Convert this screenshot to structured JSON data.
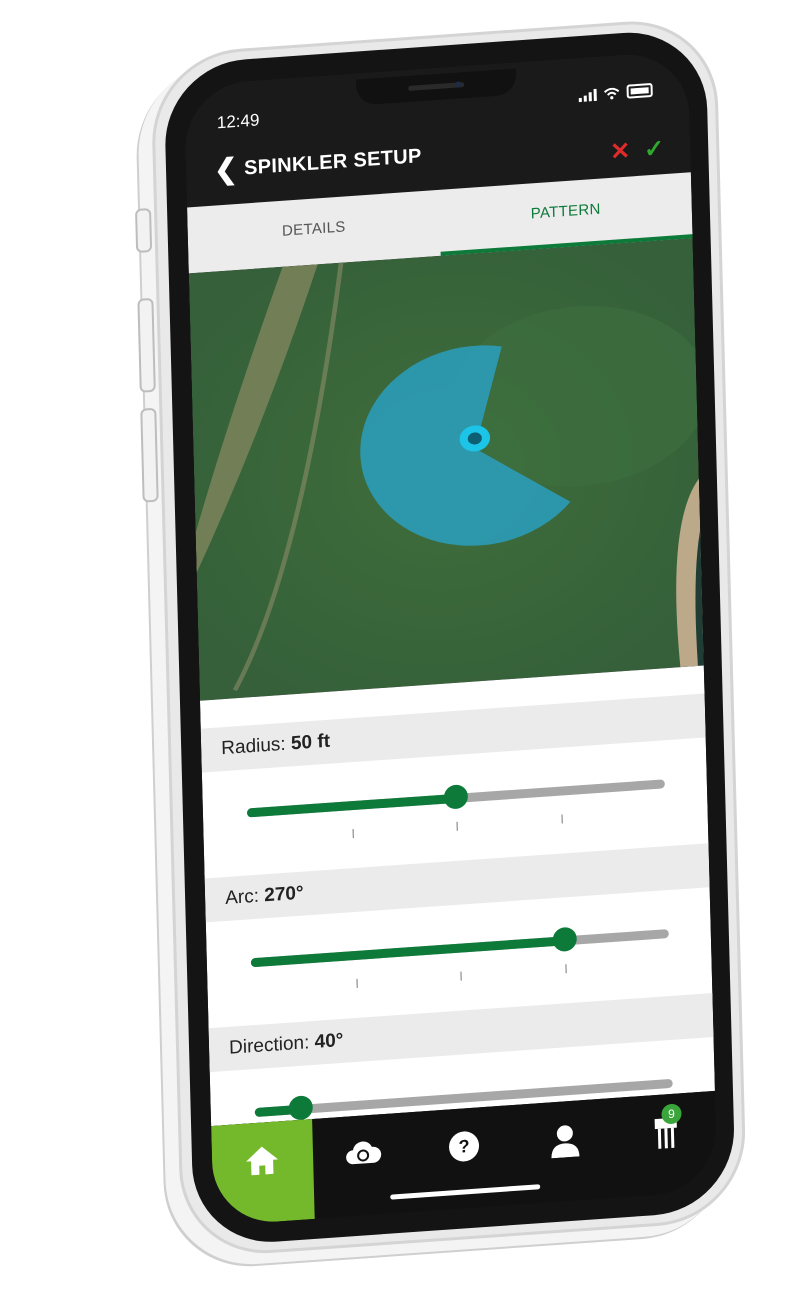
{
  "status": {
    "time": "12:49"
  },
  "header": {
    "title": "SPINKLER SETUP",
    "back_icon": "chevron-left-icon",
    "cancel_icon": "close-icon",
    "confirm_icon": "check-icon"
  },
  "tabs": [
    {
      "label": "DETAILS",
      "active": false
    },
    {
      "label": "PATTERN",
      "active": true
    }
  ],
  "controls": {
    "radius": {
      "label": "Radius:",
      "value": "50 ft",
      "fraction": 0.5
    },
    "arc": {
      "label": "Arc:",
      "value": "270°",
      "fraction": 0.75
    },
    "direction": {
      "label": "Direction:",
      "value": "40°",
      "fraction": 0.11
    }
  },
  "nav": {
    "items": [
      {
        "icon": "home-icon",
        "active": true
      },
      {
        "icon": "cloud-sync-icon"
      },
      {
        "icon": "help-icon"
      },
      {
        "icon": "user-icon"
      },
      {
        "icon": "sensor-icon",
        "badge": "9"
      }
    ]
  },
  "colors": {
    "brand_green": "#0d7a3a",
    "home_green": "#74b82c",
    "pattern_blue": "#2a9fc0",
    "cancel_red": "#e02b2b",
    "confirm_green": "#2ea82e"
  }
}
